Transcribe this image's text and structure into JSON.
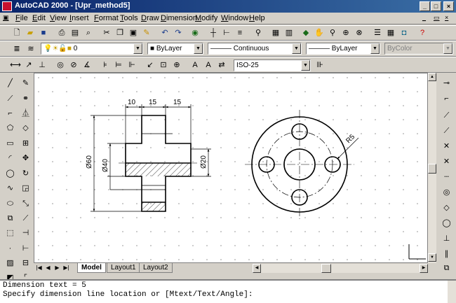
{
  "app": {
    "title": "AutoCAD 2000 - [Upr_method5]"
  },
  "menu": [
    "File",
    "Edit",
    "View",
    "Insert",
    "Format",
    "Tools",
    "Draw",
    "Dimension",
    "Modify",
    "Window",
    "Help"
  ],
  "layers": {
    "layer_name": "0",
    "color": "ByLayer",
    "linetype": "Continuous",
    "lineweight": "ByLayer",
    "plot_style": "ByColor"
  },
  "dimstyle": {
    "current": "ISO-25"
  },
  "drawing": {
    "dims": {
      "d1": "10",
      "d2": "15",
      "d3": "15",
      "dia60": "Ø60",
      "dia40": "Ø40",
      "dia20": "Ø20",
      "r5": "R5"
    }
  },
  "tabs": {
    "model": "Model",
    "layout1": "Layout1",
    "layout2": "Layout2"
  },
  "command": {
    "line1": "Dimension text = 5",
    "line2": "Specify dimension line location or [Mtext/Text/Angle]:"
  },
  "icons": {
    "title": "autocad-app-icon"
  }
}
